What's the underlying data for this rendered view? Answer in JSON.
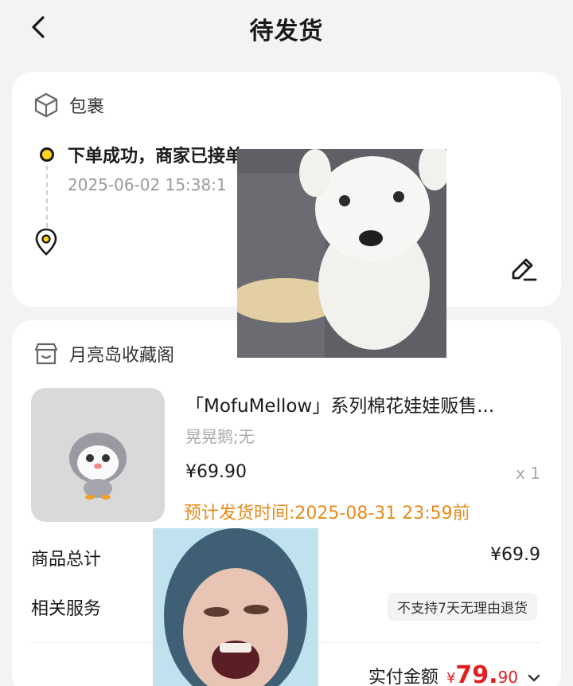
{
  "header": {
    "title": "待发货",
    "back_icon": "chevron-left-icon"
  },
  "package": {
    "label": "包裹",
    "icon": "package-box-icon",
    "status": "下单成功，商家已接单",
    "time": "2025-06-02 15:38:1",
    "location_icon": "location-pin-icon",
    "edit_icon": "edit-pen-icon",
    "status_dot_color": "#ffd21e"
  },
  "store": {
    "name": "月亮岛收藏阁",
    "icon": "store-icon"
  },
  "product": {
    "title": "「MofuMellow」系列棉花娃娃贩售...",
    "spec": "晃晃鹅;无",
    "price": "¥69.90",
    "quantity": "x 1",
    "ship_time": "预计发货时间:2025-08-31 23:59前"
  },
  "summary": {
    "goods_total_label": "商品总计",
    "goods_total_value": "¥69.9",
    "services_label": "相关服务",
    "services_tag": "不支持7天无理由退货",
    "paid_label": "实付金额",
    "paid_currency": "¥",
    "paid_int": "79.",
    "paid_dec": "90",
    "expand_icon": "chevron-down-icon"
  },
  "colors": {
    "accent": "#ffd21e",
    "price_red": "#e02020",
    "ship_orange": "#e78b1a"
  }
}
